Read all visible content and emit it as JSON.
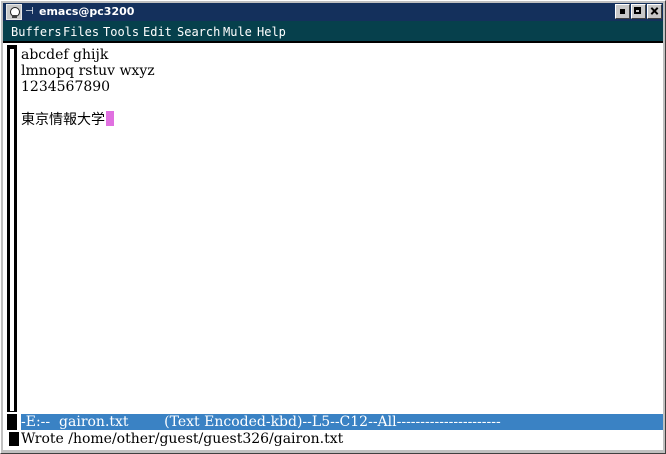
{
  "window": {
    "title": "emacs@pc3200"
  },
  "menubar": {
    "items": [
      {
        "label": "Buffers"
      },
      {
        "label": "Files"
      },
      {
        "label": "Tools"
      },
      {
        "label": "Edit"
      },
      {
        "label": "Search"
      },
      {
        "label": "Mule"
      },
      {
        "label": "Help"
      }
    ]
  },
  "buffer": {
    "lines": [
      "abcdef ghijk",
      "lmnopq rstuv wxyz",
      "1234567890",
      "",
      "東京情報大学"
    ]
  },
  "modeline": {
    "text": "-E:--  gairon.txt        (Text Encoded-kbd)--L5--C12--All----------------------"
  },
  "echo": {
    "message": "Wrote /home/other/guest/guest326/gairon.txt"
  },
  "colors": {
    "titlebar": "#14305c",
    "menubar": "#06404c",
    "modeline": "#3a82c4",
    "cursor": "#e070e0"
  },
  "icons": {
    "window_icon": "skull-icon",
    "window_menu": "window-menu-icon",
    "minimize": "minimize-icon",
    "maximize": "maximize-icon",
    "close": "close-icon"
  }
}
